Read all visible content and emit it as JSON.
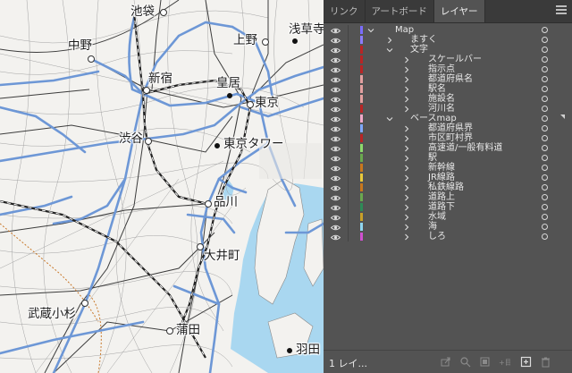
{
  "panel": {
    "tabs": [
      {
        "label": "リンク",
        "active": false
      },
      {
        "label": "アートボード",
        "active": false
      },
      {
        "label": "レイヤー",
        "active": true
      }
    ],
    "layer_count": "1 レイ...",
    "layers": [
      {
        "name": "Map",
        "depth": 0,
        "expanded": true,
        "color": "#7b6cff"
      },
      {
        "name": "ますく",
        "depth": 1,
        "expanded": false,
        "color": "#8c7cff"
      },
      {
        "name": "文字",
        "depth": 1,
        "expanded": true,
        "color": "#b82525"
      },
      {
        "name": "スケールバー",
        "depth": 2,
        "expanded": false,
        "color": "#b82525"
      },
      {
        "name": "指示点",
        "depth": 2,
        "expanded": false,
        "color": "#b82525"
      },
      {
        "name": "都道府県名",
        "depth": 2,
        "expanded": false,
        "color": "#e3a0a0"
      },
      {
        "name": "駅名",
        "depth": 2,
        "expanded": false,
        "color": "#e3a0a0"
      },
      {
        "name": "施設名",
        "depth": 2,
        "expanded": false,
        "color": "#e3a0a0"
      },
      {
        "name": "河川名",
        "depth": 2,
        "expanded": false,
        "color": "#b82525"
      },
      {
        "name": "ベースmap",
        "depth": 1,
        "expanded": true,
        "color": "#f0a8c8"
      },
      {
        "name": "都道府県界",
        "depth": 2,
        "expanded": false,
        "color": "#7fa8ff"
      },
      {
        "name": "市区町村界",
        "depth": 2,
        "expanded": false,
        "color": "#b82525"
      },
      {
        "name": "高速道/一般有料道",
        "depth": 2,
        "expanded": false,
        "color": "#8cd96b"
      },
      {
        "name": "駅",
        "depth": 2,
        "expanded": false,
        "color": "#6aa84f"
      },
      {
        "name": "新幹線",
        "depth": 2,
        "expanded": false,
        "color": "#c8781e"
      },
      {
        "name": "JR線路",
        "depth": 2,
        "expanded": false,
        "color": "#e8c83a"
      },
      {
        "name": "私鉄線路",
        "depth": 2,
        "expanded": false,
        "color": "#c8781e"
      },
      {
        "name": "道路上",
        "depth": 2,
        "expanded": false,
        "color": "#6aa84f"
      },
      {
        "name": "道路下",
        "depth": 2,
        "expanded": false,
        "color": "#2e8b57"
      },
      {
        "name": "水域",
        "depth": 2,
        "expanded": false,
        "color": "#c8a028"
      },
      {
        "name": "海",
        "depth": 2,
        "expanded": false,
        "color": "#8fd6f0"
      },
      {
        "name": "しろ",
        "depth": 2,
        "expanded": false,
        "color": "#d050d0"
      }
    ]
  },
  "map": {
    "places": [
      {
        "id": "ikebukuro",
        "name": "池袋"
      },
      {
        "id": "nakano",
        "name": "中野"
      },
      {
        "id": "shinjuku",
        "name": "新宿"
      },
      {
        "id": "shibuya",
        "name": "渋谷"
      },
      {
        "id": "ueno",
        "name": "上野"
      },
      {
        "id": "asakusa",
        "name": "浅草寺"
      },
      {
        "id": "kokyo",
        "name": "皇居"
      },
      {
        "id": "tokyo",
        "name": "東京"
      },
      {
        "id": "tokyotower",
        "name": "東京タワー"
      },
      {
        "id": "shinagawa",
        "name": "品川"
      },
      {
        "id": "oimachi",
        "name": "大井町"
      },
      {
        "id": "musashikosugi",
        "name": "武蔵小杉"
      },
      {
        "id": "kamata",
        "name": "蒲田"
      },
      {
        "id": "haneda",
        "name": "羽田"
      }
    ]
  }
}
